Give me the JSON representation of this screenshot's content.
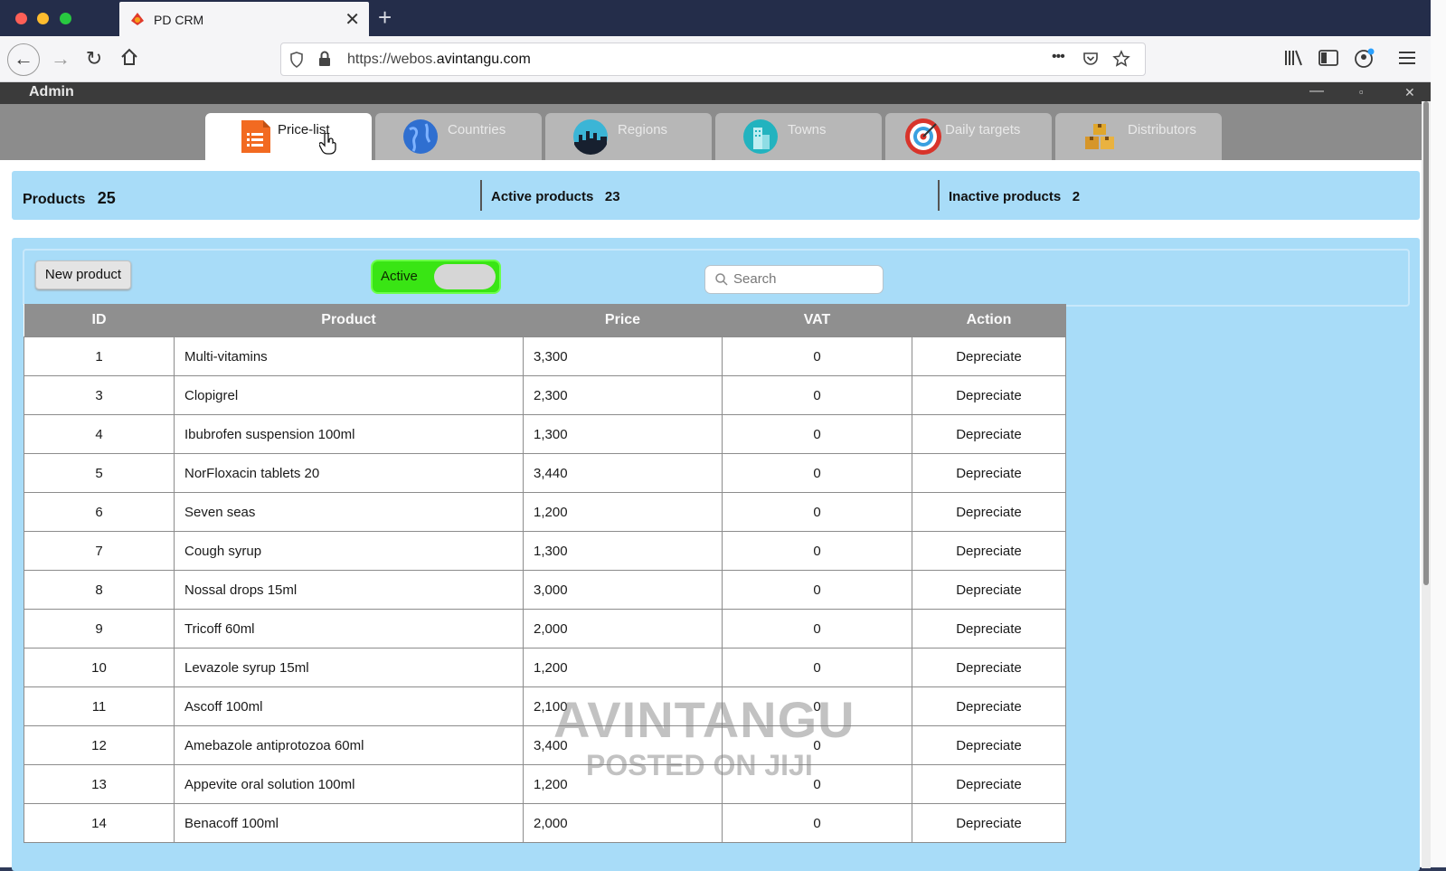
{
  "browser": {
    "tab_title": "PD CRM",
    "tab_close": "✕",
    "new_tab": "+",
    "url_prefix": "https://webos.",
    "url_domain": "avintangu.com",
    "more_dots": "•••"
  },
  "app": {
    "window_title": "Admin",
    "window_controls": {
      "minimize": "—",
      "maximize": "▫",
      "close": "✕"
    },
    "tabs": [
      {
        "label": "Price-list",
        "icon": "price-list-icon",
        "active": true
      },
      {
        "label": "Countries",
        "icon": "globe-icon",
        "active": false
      },
      {
        "label": "Regions",
        "icon": "city-skyline-icon",
        "active": false
      },
      {
        "label": "Towns",
        "icon": "building-icon",
        "active": false
      },
      {
        "label": "Daily targets",
        "icon": "target-icon",
        "active": false
      },
      {
        "label": "Distributors",
        "icon": "boxes-icon",
        "active": false
      }
    ],
    "stats": {
      "products_label": "Products",
      "products_count": "25",
      "active_label": "Active products",
      "active_count": "23",
      "inactive_label": "Inactive products",
      "inactive_count": "2"
    },
    "controls": {
      "new_product_label": "New product",
      "toggle_label": "Active",
      "search_placeholder": "Search"
    },
    "table": {
      "columns": [
        "ID",
        "Product",
        "Price",
        "VAT",
        "Action"
      ],
      "rows": [
        {
          "id": "1",
          "product": "Multi-vitamins",
          "price": "3,300",
          "vat": "0",
          "action": "Depreciate"
        },
        {
          "id": "3",
          "product": "Clopigrel",
          "price": "2,300",
          "vat": "0",
          "action": "Depreciate"
        },
        {
          "id": "4",
          "product": "Ibubrofen suspension 100ml",
          "price": "1,300",
          "vat": "0",
          "action": "Depreciate"
        },
        {
          "id": "5",
          "product": "NorFloxacin tablets 20",
          "price": "3,440",
          "vat": "0",
          "action": "Depreciate"
        },
        {
          "id": "6",
          "product": "Seven seas",
          "price": "1,200",
          "vat": "0",
          "action": "Depreciate"
        },
        {
          "id": "7",
          "product": "Cough syrup",
          "price": "1,300",
          "vat": "0",
          "action": "Depreciate"
        },
        {
          "id": "8",
          "product": "Nossal drops 15ml",
          "price": "3,000",
          "vat": "0",
          "action": "Depreciate"
        },
        {
          "id": "9",
          "product": "Tricoff 60ml",
          "price": "2,000",
          "vat": "0",
          "action": "Depreciate"
        },
        {
          "id": "10",
          "product": "Levazole syrup 15ml",
          "price": "1,200",
          "vat": "0",
          "action": "Depreciate"
        },
        {
          "id": "11",
          "product": "Ascoff 100ml",
          "price": "2,100",
          "vat": "0",
          "action": "Depreciate"
        },
        {
          "id": "12",
          "product": "Amebazole antiprotozoa 60ml",
          "price": "3,400",
          "vat": "0",
          "action": "Depreciate"
        },
        {
          "id": "13",
          "product": "Appevite oral solution 100ml",
          "price": "1,200",
          "vat": "0",
          "action": "Depreciate"
        },
        {
          "id": "14",
          "product": "Benacoff 100ml",
          "price": "2,000",
          "vat": "0",
          "action": "Depreciate"
        }
      ]
    }
  },
  "watermark": {
    "line1": "AVINTANGU",
    "line2": "POSTED ON JIJI"
  },
  "colors": {
    "panel": "#a8dcf8",
    "toggle_on": "#39e514",
    "header": "#8f8f8f"
  }
}
